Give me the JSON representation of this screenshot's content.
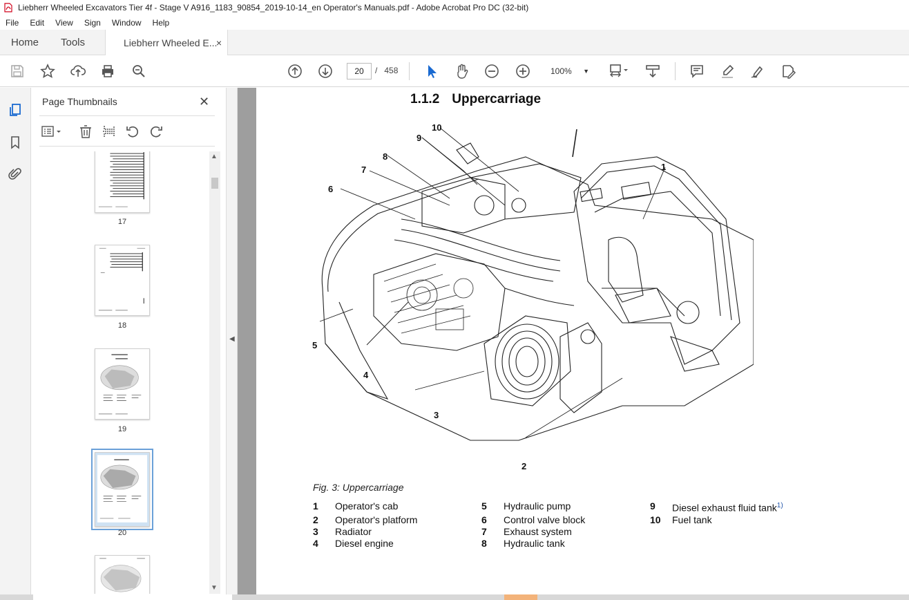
{
  "window": {
    "title": "Liebherr Wheeled Excavators Tier 4f - Stage V A916_1183_90854_2019-10-14_en Operator's Manuals.pdf - Adobe Acrobat Pro DC (32-bit)"
  },
  "menu": [
    "File",
    "Edit",
    "View",
    "Sign",
    "Window",
    "Help"
  ],
  "tabs": {
    "home": "Home",
    "tools": "Tools",
    "document": "Liebherr Wheeled E...",
    "close": "×"
  },
  "toolbar": {
    "current_page": "20",
    "page_sep": "/",
    "total_pages": "458",
    "zoom": "100%"
  },
  "panel": {
    "title": "Page Thumbnails",
    "close": "✕",
    "thumbnails": [
      {
        "label": "17"
      },
      {
        "label": "18"
      },
      {
        "label": "19"
      },
      {
        "label": "20",
        "selected": true
      },
      {
        "label": ""
      }
    ]
  },
  "document": {
    "section_number": "1.1.2",
    "section_title": "Uppercarriage",
    "callouts": [
      "1",
      "2",
      "3",
      "4",
      "5",
      "6",
      "7",
      "8",
      "9",
      "10"
    ],
    "figure_caption": "Fig. 3: Uppercarriage",
    "legend": [
      {
        "n": "1",
        "text": "Operator's cab"
      },
      {
        "n": "2",
        "text": "Operator's platform"
      },
      {
        "n": "3",
        "text": "Radiator"
      },
      {
        "n": "4",
        "text": "Diesel engine"
      },
      {
        "n": "5",
        "text": "Hydraulic pump"
      },
      {
        "n": "6",
        "text": "Control valve block"
      },
      {
        "n": "7",
        "text": "Exhaust system"
      },
      {
        "n": "8",
        "text": "Hydraulic tank"
      },
      {
        "n": "9",
        "text": "Diesel exhaust fluid tank",
        "sup": "1)"
      },
      {
        "n": "10",
        "text": "Fuel tank"
      }
    ]
  }
}
